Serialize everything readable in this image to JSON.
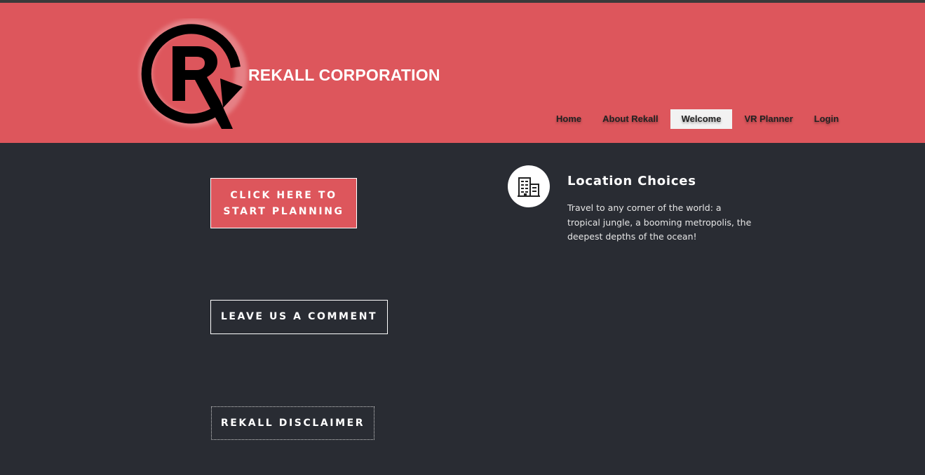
{
  "header": {
    "brand": "REKALL CORPORATION",
    "logo_icon": "rekall-r-logo",
    "background": "#dd565c"
  },
  "nav": {
    "items": [
      {
        "label": "Home",
        "active": false
      },
      {
        "label": "About Rekall",
        "active": false
      },
      {
        "label": "Welcome",
        "active": true
      },
      {
        "label": "VR Planner",
        "active": false
      },
      {
        "label": "Login",
        "active": false
      }
    ]
  },
  "buttons": {
    "plan_line1": "CLICK HERE TO",
    "plan_line2": "START PLANNING",
    "comment": "LEAVE US A COMMENT",
    "disclaimer": "REKALL DISCLAIMER"
  },
  "feature": {
    "icon": "building-icon",
    "title": "Location Choices",
    "text": "Travel to any corner of the world: a tropical jungle, a booming metropolis, the deepest depths of the ocean!"
  },
  "colors": {
    "accent": "#dd565c",
    "page_background": "#292c33"
  }
}
